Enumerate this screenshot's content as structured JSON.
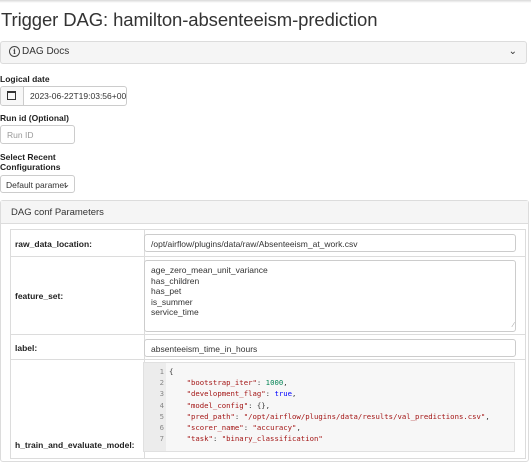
{
  "page": {
    "title": "Trigger DAG: hamilton-absenteeism-prediction"
  },
  "docs": {
    "label": "DAG Docs"
  },
  "logical_date": {
    "label": "Logical date",
    "value": "2023-06-22T19:03:56+00:0("
  },
  "run_id": {
    "label": "Run id (Optional)",
    "placeholder": "Run ID"
  },
  "recent_configs": {
    "label_line1": "Select Recent",
    "label_line2": "Configurations",
    "selected": "Default paramet"
  },
  "conf": {
    "header": "DAG conf Parameters",
    "raw_data_location": {
      "key": "raw_data_location:",
      "value": "/opt/airflow/plugins/data/raw/Absenteeism_at_work.csv"
    },
    "feature_set": {
      "key": "feature_set:",
      "values": [
        "age_zero_mean_unit_variance",
        "has_children",
        "has_pet",
        "is_summer",
        "service_time"
      ]
    },
    "label": {
      "key": "label:",
      "value": "absenteeism_time_in_hours"
    },
    "train_eval": {
      "key": "h_train_and_evaluate_model:",
      "lines": [
        {
          "n": "1",
          "t": "{"
        },
        {
          "n": "2",
          "t": "    \"bootstrap_iter\": 1000,"
        },
        {
          "n": "3",
          "t": "    \"development_flag\": true,"
        },
        {
          "n": "4",
          "t": "    \"model_config\": {},"
        },
        {
          "n": "5",
          "t": "    \"pred_path\": \"/opt/airflow/plugins/data/results/val_predictions.csv\","
        },
        {
          "n": "6",
          "t": "    \"scorer_name\": \"accuracy\","
        },
        {
          "n": "7",
          "t": "    \"task\": \"binary_classification\""
        }
      ]
    }
  }
}
